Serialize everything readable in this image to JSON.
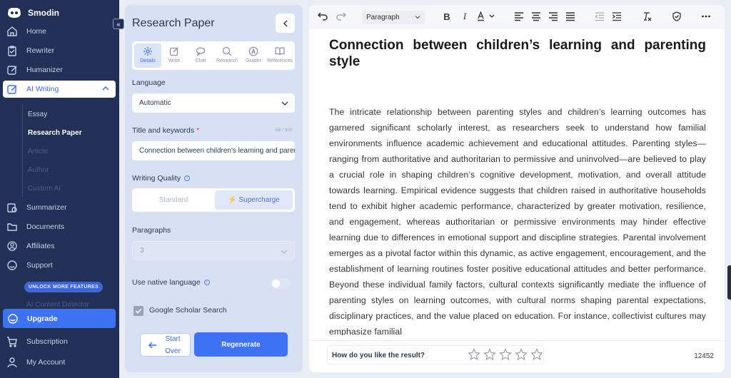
{
  "sidebar": {
    "brand": "Smodin",
    "nav": [
      {
        "label": "Home",
        "icon": "home-icon"
      },
      {
        "label": "Rewriter",
        "icon": "rewriter-icon"
      },
      {
        "label": "Humanizer",
        "icon": "humanizer-icon"
      },
      {
        "label": "AI Writing",
        "icon": "ai-writing-icon"
      }
    ],
    "sub": [
      "Essay",
      "Research Paper",
      "Article",
      "Author",
      "Custom AI"
    ],
    "nav2": [
      {
        "label": "Summarizer",
        "icon": "summarizer-icon"
      },
      {
        "label": "Documents",
        "icon": "documents-icon"
      },
      {
        "label": "Affiliates",
        "icon": "affiliates-icon"
      },
      {
        "label": "Support",
        "icon": "support-icon"
      }
    ],
    "unlock": "UNLOCK MORE FEATURES",
    "ai_detector": "AI Content Detector",
    "upgrade": "Upgrade",
    "bottom": [
      {
        "label": "Subscription",
        "icon": "cart-icon"
      },
      {
        "label": "My Account",
        "icon": "account-icon"
      }
    ]
  },
  "panel": {
    "title": "Research Paper",
    "tabs": [
      "Details",
      "Write",
      "Chat",
      "Research",
      "Grader",
      "References"
    ],
    "language_label": "Language",
    "language_value": "Automatic",
    "title_label": "Title and keywords",
    "title_required": "*",
    "title_counter": "58 / 300",
    "title_value": "Connection between children's learning and parenting style",
    "quality_label": "Writing Quality",
    "quality_standard": "Standard",
    "quality_supercharge": "⚡ Supercharge",
    "paragraphs_label": "Paragraphs",
    "paragraphs_value": "3",
    "native_label": "Use native language",
    "scholar_label": "Google Scholar Search",
    "start_over": "Start Over",
    "regenerate": "Regenerate"
  },
  "editor": {
    "paragraph_style": "Paragraph",
    "heading": "Connection between children’s learning and parenting style",
    "body": "The intricate relationship between parenting styles and children’s learning outcomes has garnered significant scholarly interest, as researchers seek to understand how familial environments influence academic achievement and educational attitudes. Parenting styles—ranging from authoritative and authoritarian to permissive and uninvolved—are believed to play a crucial role in shaping children’s cognitive development, motivation, and overall attitude towards learning. Empirical evidence suggests that children raised in authoritative households tend to exhibit higher academic performance, characterized by greater motivation, resilience, and engagement, whereas authoritarian or permissive environments may hinder effective learning due to differences in emotional support and discipline strategies. Parental involvement emerges as a pivotal factor within this dynamic, as active engagement, encouragement, and the establishment of learning routines foster positive educational attitudes and better performance. Beyond these individual family factors, cultural contexts significantly mediate the influence of parenting styles on learning outcomes, with cultural norms shaping parental expectations, disciplinary practices, and the value placed on education. For instance, collectivist cultures may emphasize familial",
    "rating_question": "How do you like the result?",
    "word_count": "12452"
  },
  "colors": {
    "sidebar_bg": "#223058",
    "accent": "#3d72f5",
    "panel_bg": "#d8e0f4"
  }
}
